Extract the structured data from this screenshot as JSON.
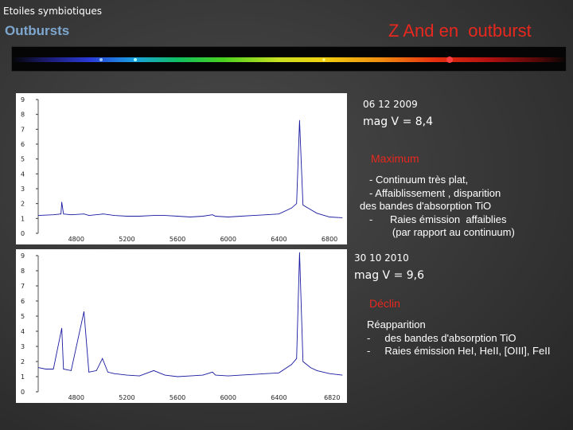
{
  "header": {
    "topic": "Etoiles symbiotiques",
    "section": "Outbursts",
    "title": "Z And en  outburst"
  },
  "observations": [
    {
      "date": "06 12 2009",
      "magnitude": "mag V = 8,4",
      "phase": "Maximum",
      "notes": [
        "- Continuum très plat,",
        "- Affaiblissement , disparition",
        "des bandes d'absorption TiO",
        "-      Raies émission  affaiblies",
        "        (par rapport au continuum)"
      ]
    },
    {
      "date": "30 10 2010",
      "magnitude": "mag V = 9,6",
      "phase": "Déclin",
      "notes": [
        "Réapparition",
        "-     des bandes d'absorption TiO",
        "-     Raies émission HeI, HeII, [OIII], FeII"
      ]
    }
  ],
  "chart_data": [
    {
      "type": "line",
      "title": "",
      "xlabel": "",
      "ylabel": "",
      "ylim": [
        0,
        9
      ],
      "yticks": [
        "9",
        "8",
        "7",
        "6",
        "5",
        "4",
        "3",
        "2",
        "1",
        "0"
      ],
      "xticks": [
        "4800",
        "5200",
        "5600",
        "6000",
        "6400",
        "6800"
      ],
      "x": [
        4500,
        4620,
        4680,
        4686,
        4700,
        4760,
        4861,
        4900,
        5015,
        5100,
        5200,
        5300,
        5412,
        5500,
        5600,
        5700,
        5800,
        5876,
        5900,
        6000,
        6100,
        6200,
        6300,
        6400,
        6500,
        6540,
        6563,
        6590,
        6650,
        6700,
        6800,
        6900
      ],
      "y": [
        1.2,
        1.25,
        1.3,
        2.1,
        1.3,
        1.25,
        1.3,
        1.2,
        1.3,
        1.2,
        1.15,
        1.15,
        1.2,
        1.2,
        1.15,
        1.1,
        1.15,
        1.25,
        1.15,
        1.1,
        1.15,
        1.2,
        1.25,
        1.3,
        1.7,
        2.0,
        7.6,
        1.9,
        1.6,
        1.35,
        1.1,
        1.05
      ],
      "line_color": "#1a1aa0"
    },
    {
      "type": "line",
      "title": "",
      "xlabel": "",
      "ylabel": "",
      "ylim": [
        0,
        9
      ],
      "yticks": [
        "9",
        "8",
        "7",
        "6",
        "5",
        "4",
        "3",
        "2",
        "1",
        "0"
      ],
      "xticks": [
        "4800",
        "5200",
        "5600",
        "6000",
        "6400",
        "6820"
      ],
      "x": [
        4500,
        4560,
        4620,
        4686,
        4700,
        4760,
        4861,
        4900,
        4960,
        5007,
        5050,
        5100,
        5200,
        5300,
        5412,
        5500,
        5600,
        5700,
        5800,
        5876,
        5900,
        6000,
        6100,
        6200,
        6300,
        6400,
        6500,
        6540,
        6563,
        6590,
        6650,
        6700,
        6800,
        6900
      ],
      "y": [
        1.6,
        1.5,
        1.5,
        4.2,
        1.5,
        1.4,
        5.3,
        1.3,
        1.4,
        2.2,
        1.3,
        1.2,
        1.1,
        1.05,
        1.4,
        1.1,
        1.0,
        1.05,
        1.1,
        1.3,
        1.1,
        1.05,
        1.1,
        1.15,
        1.2,
        1.25,
        1.8,
        2.2,
        9.2,
        2.0,
        1.6,
        1.4,
        1.2,
        1.1
      ],
      "line_color": "#1a1aa0"
    }
  ]
}
